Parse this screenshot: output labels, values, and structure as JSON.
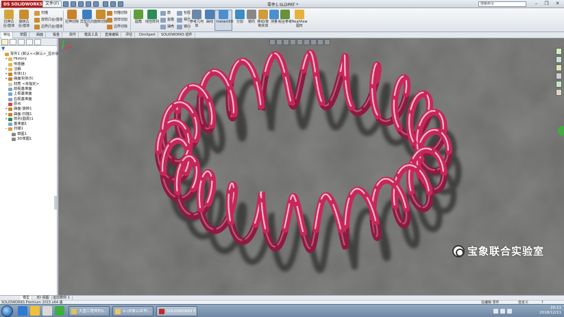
{
  "app": {
    "logo_text": "SOLIDWORKS",
    "logo_mark": "DS",
    "menu_button": "文件(F)",
    "document_title": "零件1.SLDPRT *",
    "search_placeholder": "搜索命令"
  },
  "window_controls": {
    "minimize": "–",
    "restore": "❐",
    "close": "✕"
  },
  "ribbon": {
    "big_buttons": [
      {
        "label": "拉伸凸台/基体",
        "color": "#d4a43b"
      },
      {
        "label": "旋转凸台/基体",
        "color": "#c98d2f"
      },
      {
        "label": "拉伸切除",
        "color": "#c9812d"
      },
      {
        "label": "异型孔向导",
        "color": "#3b7ec4"
      },
      {
        "label": "旋转切除",
        "color": "#c98d2f"
      },
      {
        "label": "圆角",
        "color": "#5f9f3a"
      },
      {
        "label": "线性阵列",
        "color": "#2e8b57"
      },
      {
        "label": "参考几何体",
        "color": "#6b88a8"
      },
      {
        "label": "曲线",
        "color": "#4f7fb7"
      },
      {
        "label": "Instant3D",
        "color": "#4c8fcf"
      },
      {
        "label": "分割",
        "color": "#3c8dc2"
      },
      {
        "label": "镜向",
        "color": "#888888"
      },
      {
        "label": "移动/复制实体",
        "color": "#d19a3a"
      },
      {
        "label": "测量",
        "color": "#4c8fcf"
      },
      {
        "label": "组合参考",
        "color": "#6a8f3d"
      },
      {
        "label": "RealView 图形",
        "color": "#e5b23b"
      }
    ],
    "small_buttons": [
      {
        "label": "扫描",
        "color": "#d19a3a"
      },
      {
        "label": "放样凸台/基体",
        "color": "#c98d2f"
      },
      {
        "label": "边界凸台/基体",
        "color": "#c58a2a"
      },
      {
        "label": "扫描切除",
        "color": "#c9812d"
      },
      {
        "label": "放样切割",
        "color": "#c9812d"
      },
      {
        "label": "边界切除",
        "color": "#c9812d"
      },
      {
        "label": "筋",
        "color": "#8aa2bd"
      },
      {
        "label": "拔模",
        "color": "#8aa2bd"
      },
      {
        "label": "抽壳",
        "color": "#8aa2bd"
      },
      {
        "label": "包覆",
        "color": "#8aa2bd"
      },
      {
        "label": "相交",
        "color": "#8aa2bd"
      },
      {
        "label": "镜向",
        "color": "#8aa2bd"
      }
    ]
  },
  "command_tabs": [
    "特征",
    "草图",
    "曲面",
    "钣金",
    "焊件",
    "模具工具",
    "直接编辑",
    "评估",
    "DimXpert",
    "SOLIDWORKS 插件"
  ],
  "feature_tree": {
    "items": [
      {
        "label": "零件1 (默认<<默认>_显示状态",
        "depth": 0,
        "expander": "",
        "color": "#d4a43b"
      },
      {
        "label": "History",
        "depth": 1,
        "expander": "+",
        "color": "#e0b64a"
      },
      {
        "label": "传感器",
        "depth": 1,
        "expander": "",
        "color": "#e0b64a"
      },
      {
        "label": "注解",
        "depth": 1,
        "expander": "+",
        "color": "#e0b64a"
      },
      {
        "label": "实体(1)",
        "depth": 1,
        "expander": "+",
        "color": "#c9812d"
      },
      {
        "label": "曲面实体(5)",
        "depth": 1,
        "expander": "+",
        "color": "#c9812d"
      },
      {
        "label": "材质 <未指定>",
        "depth": 1,
        "expander": "",
        "color": "#d4c8a0"
      },
      {
        "label": "前视基准面",
        "depth": 1,
        "expander": "",
        "color": "#7ea4cc"
      },
      {
        "label": "上视基准面",
        "depth": 1,
        "expander": "",
        "color": "#7ea4cc"
      },
      {
        "label": "右视基准面",
        "depth": 1,
        "expander": "",
        "color": "#7ea4cc"
      },
      {
        "label": "原点",
        "depth": 1,
        "expander": "",
        "color": "#c44f4f"
      },
      {
        "label": "曲面-旋转1",
        "depth": 1,
        "expander": "+",
        "color": "#c9812d"
      },
      {
        "label": "曲面-扫描1",
        "depth": 1,
        "expander": "+",
        "color": "#c9812d"
      },
      {
        "label": "阵列(圆周)1",
        "depth": 1,
        "expander": "+",
        "color": "#2e8b57"
      },
      {
        "label": "基准面1",
        "depth": 1,
        "expander": "",
        "color": "#7ea4cc"
      },
      {
        "label": "扫描1",
        "depth": 1,
        "expander": "−",
        "color": "#d19a3a"
      },
      {
        "label": "草图1",
        "depth": 2,
        "expander": "",
        "color": "#888888"
      },
      {
        "label": "3D草图1",
        "depth": 2,
        "expander": "",
        "color": "#888888"
      }
    ]
  },
  "model_tabs": [
    "模型",
    "3D 视图",
    "运动算例 1"
  ],
  "status": {
    "left": "SOLIDWORKS Premium 2015 x64 版",
    "mode": "在编辑 零件",
    "units": "自定义",
    "help": "?"
  },
  "taskbar": {
    "tasks": [
      {
        "label": "大国工程师的S...",
        "color": "#e0c25a",
        "active": false
      },
      {
        "label": "G:\\刘俊公众号\\...",
        "color": "#e8c766",
        "active": false
      },
      {
        "label": "SOLIDWORKS P...",
        "color": "#c22b2b",
        "active": true
      }
    ],
    "clock_time": "20:11",
    "clock_date": "2018/12/11"
  },
  "watermark": "宝象联合实验室",
  "viewport": {
    "background": "#6d6d6b",
    "coil_color": "#c8275a",
    "coil_highlight": "#ffd6e4"
  }
}
